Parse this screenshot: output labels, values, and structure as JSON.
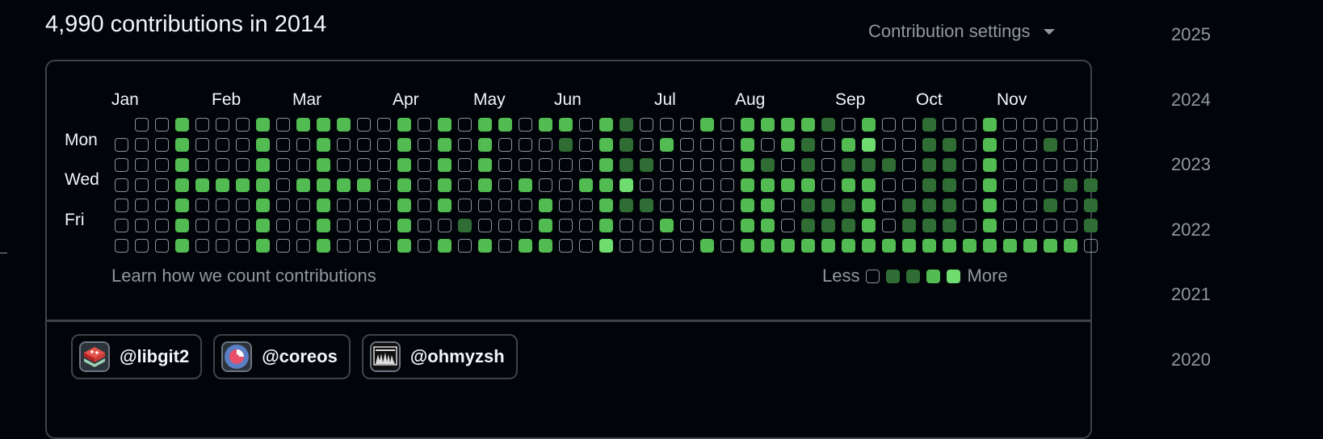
{
  "heading": "4,990 contributions in 2014",
  "settings_label": "Contribution settings",
  "months": [
    "Jan",
    "Feb",
    "Mar",
    "Apr",
    "May",
    "Jun",
    "Jul",
    "Aug",
    "Sep",
    "Oct",
    "Nov"
  ],
  "days": [
    "Mon",
    "Wed",
    "Fri"
  ],
  "learn_link": "Learn how we count contributions",
  "legend": {
    "less": "Less",
    "more": "More"
  },
  "orgs": [
    {
      "name": "@libgit2",
      "icon": "libgit2-logo-icon"
    },
    {
      "name": "@coreos",
      "icon": "coreos-logo-icon"
    },
    {
      "name": "@ohmyzsh",
      "icon": "ohmyzsh-logo-icon"
    }
  ],
  "years": [
    "2025",
    "2024",
    "2023",
    "2022",
    "2021",
    "2020"
  ],
  "colors": {
    "empty_border": "#8b949e",
    "level2": "#2f6d35",
    "level3": "#52bb52",
    "level4": "#6fdc6f"
  },
  "grid": {
    "columns": [
      [
        -1,
        0,
        0,
        0,
        0,
        0,
        0
      ],
      [
        0,
        0,
        0,
        0,
        0,
        0,
        0
      ],
      [
        0,
        0,
        0,
        0,
        0,
        0,
        0
      ],
      [
        3,
        3,
        3,
        3,
        3,
        3,
        3
      ],
      [
        0,
        0,
        0,
        3,
        0,
        0,
        0
      ],
      [
        0,
        0,
        0,
        3,
        0,
        0,
        0
      ],
      [
        0,
        0,
        0,
        3,
        0,
        0,
        0
      ],
      [
        3,
        3,
        3,
        3,
        3,
        3,
        3
      ],
      [
        0,
        0,
        0,
        0,
        0,
        0,
        0
      ],
      [
        3,
        0,
        0,
        3,
        0,
        0,
        0
      ],
      [
        3,
        3,
        3,
        3,
        3,
        3,
        3
      ],
      [
        3,
        0,
        0,
        3,
        0,
        0,
        0
      ],
      [
        0,
        0,
        0,
        3,
        0,
        0,
        0
      ],
      [
        0,
        0,
        0,
        0,
        0,
        0,
        0
      ],
      [
        3,
        3,
        3,
        3,
        3,
        3,
        3
      ],
      [
        0,
        0,
        0,
        0,
        0,
        0,
        0
      ],
      [
        3,
        3,
        3,
        3,
        3,
        0,
        3
      ],
      [
        0,
        0,
        0,
        0,
        0,
        2,
        0
      ],
      [
        3,
        3,
        3,
        3,
        0,
        0,
        3
      ],
      [
        3,
        0,
        0,
        0,
        0,
        0,
        0
      ],
      [
        0,
        0,
        0,
        3,
        0,
        0,
        3
      ],
      [
        3,
        0,
        0,
        0,
        3,
        3,
        3
      ],
      [
        3,
        2,
        0,
        0,
        0,
        0,
        0
      ],
      [
        0,
        0,
        0,
        3,
        0,
        0,
        0
      ],
      [
        3,
        3,
        3,
        3,
        3,
        3,
        4
      ],
      [
        2,
        2,
        2,
        4,
        2,
        0,
        0
      ],
      [
        0,
        0,
        2,
        0,
        2,
        0,
        0
      ],
      [
        0,
        3,
        0,
        0,
        0,
        3,
        0
      ],
      [
        0,
        0,
        0,
        0,
        0,
        0,
        0
      ],
      [
        3,
        0,
        0,
        0,
        0,
        0,
        3
      ],
      [
        0,
        0,
        0,
        0,
        0,
        0,
        0
      ],
      [
        3,
        3,
        3,
        3,
        3,
        3,
        3
      ],
      [
        3,
        0,
        2,
        3,
        3,
        3,
        3
      ],
      [
        3,
        3,
        0,
        3,
        0,
        0,
        3
      ],
      [
        3,
        2,
        2,
        3,
        2,
        2,
        3
      ],
      [
        2,
        0,
        0,
        0,
        2,
        2,
        3
      ],
      [
        0,
        3,
        2,
        3,
        2,
        2,
        3
      ],
      [
        3,
        4,
        2,
        3,
        3,
        3,
        3
      ],
      [
        0,
        0,
        2,
        0,
        0,
        0,
        3
      ],
      [
        0,
        0,
        0,
        0,
        2,
        2,
        3
      ],
      [
        2,
        2,
        2,
        2,
        2,
        2,
        3
      ],
      [
        0,
        2,
        2,
        2,
        2,
        2,
        3
      ],
      [
        0,
        0,
        0,
        0,
        0,
        0,
        3
      ],
      [
        3,
        3,
        3,
        3,
        3,
        3,
        3
      ],
      [
        0,
        0,
        0,
        0,
        0,
        0,
        3
      ],
      [
        0,
        0,
        0,
        0,
        0,
        0,
        3
      ],
      [
        0,
        2,
        0,
        0,
        2,
        0,
        3
      ],
      [
        0,
        0,
        0,
        2,
        0,
        0,
        3
      ],
      [
        0,
        0,
        0,
        2,
        2,
        2,
        0
      ]
    ]
  }
}
